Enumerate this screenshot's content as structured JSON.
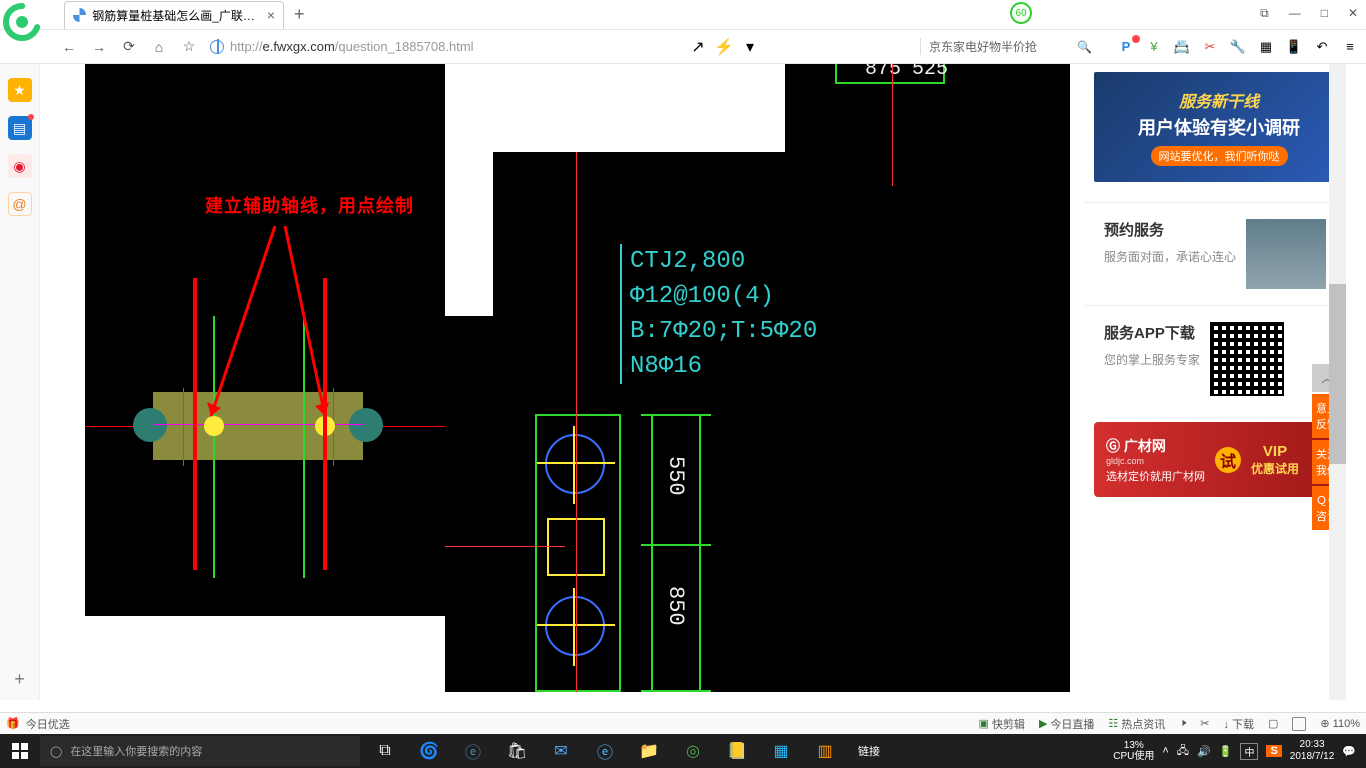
{
  "browser": {
    "tab_title": "钢筋算量桩基础怎么画_广联达服",
    "badge": "60",
    "url_prefix": "http://",
    "url_domain": "e.fwxgx.com",
    "url_path": "/question_1885708.html",
    "search_placeholder": "京东家电好物半价抢"
  },
  "win": {
    "popout": "⧉",
    "min": "—",
    "max": "□",
    "close": "✕"
  },
  "nav": {
    "back": "←",
    "fwd": "→",
    "reload": "⟳",
    "home": "⌂",
    "star": "☆",
    "share": "↗",
    "bolt": "⚡",
    "down": "▾",
    "mag": "🔍"
  },
  "toolbar_icons": {
    "p": "P",
    "yuan": "¥",
    "account": "📇",
    "scissors": "✂",
    "wrench": "🔧",
    "grid": "▦",
    "phone": "📱",
    "undo": "↶",
    "menu": "≡"
  },
  "sidebar": {
    "star": "★",
    "news": "▤",
    "weibo": "◉",
    "mail": "@",
    "plus": "+"
  },
  "cad": {
    "annotation": "建立辅助轴线，用点绘制",
    "labels": {
      "ctj": "CTJ2,800",
      "phi12": "Φ12@100(4)",
      "bt": "B:7Φ20;T:5Φ20",
      "n8": "N8Φ16",
      "d550": "550",
      "d850": "850",
      "d875": "875",
      "d525": "525"
    }
  },
  "rside": {
    "ad1": {
      "l1": "服务新干线",
      "l2": "用户体验有奖小调研",
      "pill": "网站要优化，我们听你哒"
    },
    "box1": {
      "title": "预约服务",
      "desc": "服务面对面，承诺心连心"
    },
    "box2": {
      "title": "服务APP下载",
      "desc": "您的掌上服务专家"
    },
    "ad2": {
      "brand": "广材网",
      "sub": "gldjc.com",
      "slogan": "选材定价就用广材网",
      "try": "试",
      "vip": "VIP",
      "vip2": "优惠试用"
    },
    "float": {
      "top": "︿",
      "f1": "意见反馈",
      "f2": "关注我们",
      "f3": "ＱＱ咨询"
    }
  },
  "status": {
    "left": "今日优选",
    "s1": "快剪辑",
    "s2": "今日直播",
    "s3": "热点资讯",
    "download": "↓ 下载",
    "zoom": "⊕ 110%"
  },
  "taskbar": {
    "search_placeholder": "在这里输入你要搜索的内容",
    "link": "链接",
    "cpu_pct": "13%",
    "cpu_lbl": "CPU使用",
    "input": "中",
    "s": "S",
    "time": "20:33",
    "date": "2018/7/12"
  }
}
